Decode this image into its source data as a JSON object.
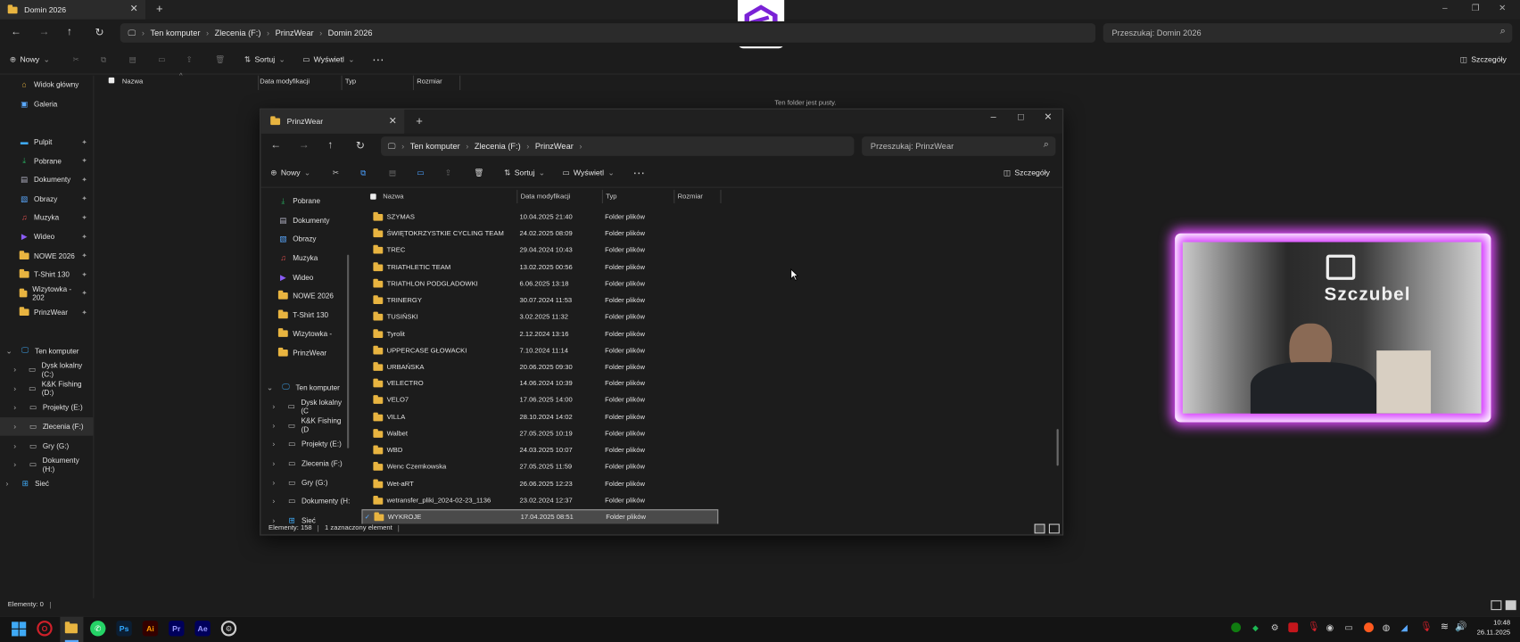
{
  "back_window": {
    "tab_title": "Domin 2026",
    "breadcrumb": [
      "Ten komputer",
      "Zlecenia (F:)",
      "PrinzWear",
      "Domin 2026"
    ],
    "search_placeholder": "Przeszukaj: Domin 2026",
    "cmd": {
      "new": "Nowy",
      "sort": "Sortuj",
      "view": "Wyświetl",
      "details": "Szczegóły"
    },
    "columns": {
      "name": "Nazwa",
      "modified": "Data modyfikacji",
      "type": "Typ",
      "size": "Rozmiar"
    },
    "empty_text": "Ten folder jest pusty.",
    "sidebar": [
      {
        "label": "Widok główny",
        "icon": "home-icon",
        "pin": false
      },
      {
        "label": "Galeria",
        "icon": "gallery-icon",
        "pin": false
      },
      {
        "label": "Pulpit",
        "icon": "desktop-icon",
        "pin": true
      },
      {
        "label": "Pobrane",
        "icon": "download-icon",
        "pin": true
      },
      {
        "label": "Dokumenty",
        "icon": "document-icon",
        "pin": true
      },
      {
        "label": "Obrazy",
        "icon": "image-icon",
        "pin": true
      },
      {
        "label": "Muzyka",
        "icon": "music-icon",
        "pin": true
      },
      {
        "label": "Wideo",
        "icon": "video-icon",
        "pin": true
      },
      {
        "label": "NOWE 2026",
        "icon": "folder-icon",
        "pin": true
      },
      {
        "label": "T-Shirt 130",
        "icon": "folder-icon",
        "pin": true
      },
      {
        "label": "Wizytowka - 202",
        "icon": "folder-icon",
        "pin": true
      },
      {
        "label": "PrinzWear",
        "icon": "folder-icon",
        "pin": true
      }
    ],
    "tree": [
      {
        "label": "Ten komputer",
        "icon": "computer-icon",
        "expanded": true
      },
      {
        "label": "Dysk lokalny (C:)",
        "icon": "drive-icon"
      },
      {
        "label": "K&K Fishing (D:)",
        "icon": "drive-icon"
      },
      {
        "label": "Projekty (E:)",
        "icon": "drive-icon"
      },
      {
        "label": "Zlecenia (F:)",
        "icon": "drive-icon",
        "selected": true
      },
      {
        "label": "Gry (G:)",
        "icon": "drive-icon"
      },
      {
        "label": "Dokumenty (H:)",
        "icon": "drive-icon"
      },
      {
        "label": "Sieć",
        "icon": "network-icon"
      }
    ],
    "status": "Elementy: 0"
  },
  "front_window": {
    "tab_title": "PrinzWear",
    "breadcrumb": [
      "Ten komputer",
      "Zlecenia (F:)",
      "PrinzWear"
    ],
    "search_placeholder": "Przeszukaj: PrinzWear",
    "cmd": {
      "new": "Nowy",
      "sort": "Sortuj",
      "view": "Wyświetl",
      "details": "Szczegóły"
    },
    "columns": {
      "name": "Nazwa",
      "modified": "Data modyfikacji",
      "type": "Typ",
      "size": "Rozmiar"
    },
    "sidebar": [
      {
        "label": "Pobrane",
        "icon": "download-icon"
      },
      {
        "label": "Dokumenty",
        "icon": "document-icon"
      },
      {
        "label": "Obrazy",
        "icon": "image-icon"
      },
      {
        "label": "Muzyka",
        "icon": "music-icon"
      },
      {
        "label": "Wideo",
        "icon": "video-icon"
      },
      {
        "label": "NOWE 2026",
        "icon": "folder-icon"
      },
      {
        "label": "T-Shirt 130",
        "icon": "folder-icon"
      },
      {
        "label": "Wizytowka -",
        "icon": "folder-icon"
      },
      {
        "label": "PrinzWear",
        "icon": "folder-icon"
      }
    ],
    "tree": [
      {
        "label": "Ten komputer",
        "icon": "computer-icon"
      },
      {
        "label": "Dysk lokalny (C",
        "icon": "drive-icon"
      },
      {
        "label": "K&K Fishing (D",
        "icon": "drive-icon"
      },
      {
        "label": "Projekty (E:)",
        "icon": "drive-icon"
      },
      {
        "label": "Zlecenia (F:)",
        "icon": "drive-icon"
      },
      {
        "label": "Gry (G:)",
        "icon": "drive-icon"
      },
      {
        "label": "Dokumenty (H:",
        "icon": "drive-icon"
      },
      {
        "label": "Sieć",
        "icon": "network-icon"
      }
    ],
    "files": [
      {
        "name": "SZYMAS",
        "date": "10.04.2025 21:40",
        "type": "Folder plików"
      },
      {
        "name": "ŚWIĘTOKRZYSTKIE CYCLING TEAM",
        "date": "24.02.2025 08:09",
        "type": "Folder plików"
      },
      {
        "name": "TREC",
        "date": "29.04.2024 10:43",
        "type": "Folder plików"
      },
      {
        "name": "TRIATHLETIC TEAM",
        "date": "13.02.2025 00:56",
        "type": "Folder plików"
      },
      {
        "name": "TRIATHLON PODGLADOWKI",
        "date": "6.06.2025 13:18",
        "type": "Folder plików"
      },
      {
        "name": "TRINERGY",
        "date": "30.07.2024 11:53",
        "type": "Folder plików"
      },
      {
        "name": "TUSIŃSKI",
        "date": "3.02.2025 11:32",
        "type": "Folder plików"
      },
      {
        "name": "Tyrolit",
        "date": "2.12.2024 13:16",
        "type": "Folder plików"
      },
      {
        "name": "UPPERCASE GŁOWACKI",
        "date": "7.10.2024 11:14",
        "type": "Folder plików"
      },
      {
        "name": "URBAŃSKA",
        "date": "20.06.2025 09:30",
        "type": "Folder plików"
      },
      {
        "name": "VELECTRO",
        "date": "14.06.2024 10:39",
        "type": "Folder plików"
      },
      {
        "name": "VELO7",
        "date": "17.06.2025 14:00",
        "type": "Folder plików"
      },
      {
        "name": "VILLA",
        "date": "28.10.2024 14:02",
        "type": "Folder plików"
      },
      {
        "name": "Walbet",
        "date": "27.05.2025 10:19",
        "type": "Folder plików"
      },
      {
        "name": "WBD",
        "date": "24.03.2025 10:07",
        "type": "Folder plików"
      },
      {
        "name": "Wenc Czemkowska",
        "date": "27.05.2025 11:59",
        "type": "Folder plików"
      },
      {
        "name": "Wet-aRT",
        "date": "26.06.2025 12:23",
        "type": "Folder plików"
      },
      {
        "name": "wetransfer_pliki_2024-02-23_1136",
        "date": "23.02.2024 12:37",
        "type": "Folder plików"
      },
      {
        "name": "WYKROJE",
        "date": "17.04.2025 08:51",
        "type": "Folder plików",
        "selected": true
      }
    ],
    "status_count": "Elementy: 158",
    "status_selected": "1 zaznaczony element"
  },
  "webcam": {
    "overlay_text": "Szczubel"
  },
  "taskbar": {
    "time": "10:48",
    "date": "26.11.2025"
  }
}
